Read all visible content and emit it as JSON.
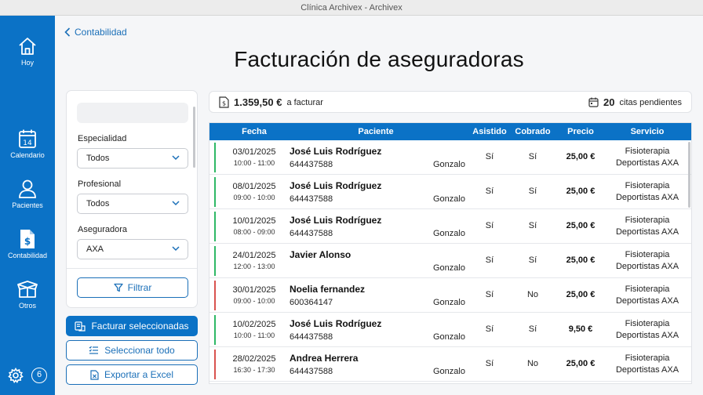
{
  "window": {
    "title": "Clínica Archivex - Archivex"
  },
  "sidebar": {
    "items": [
      {
        "label": "Hoy",
        "icon": "home-icon"
      },
      {
        "label": "Calendario",
        "icon": "calendar-icon",
        "day": "14"
      },
      {
        "label": "Pacientes",
        "icon": "user-icon"
      },
      {
        "label": "Contabilidad",
        "icon": "invoice-icon"
      },
      {
        "label": "Otros",
        "icon": "box-icon"
      }
    ],
    "badge": "6"
  },
  "breadcrumb": {
    "back_label": "Contabilidad"
  },
  "page": {
    "title": "Facturación de aseguradoras"
  },
  "filters": {
    "especialidad": {
      "label": "Especialidad",
      "value": "Todos"
    },
    "profesional": {
      "label": "Profesional",
      "value": "Todos"
    },
    "aseguradora": {
      "label": "Aseguradora",
      "value": "AXA"
    },
    "filter_button": "Filtrar"
  },
  "actions": {
    "facturar": "Facturar seleccionadas",
    "seleccionar": "Seleccionar todo",
    "exportar": "Exportar a Excel"
  },
  "summary": {
    "amount": "1.359,50 €",
    "amount_suffix": "a facturar",
    "count": "20",
    "count_suffix": "citas pendientes"
  },
  "table": {
    "headers": [
      "Fecha",
      "Paciente",
      "Asistido",
      "Cobrado",
      "Precio",
      "Servicio"
    ],
    "rows": [
      {
        "date": "03/01/2025",
        "time": "10:00 - 11:00",
        "name": "José Luis Rodríguez",
        "phone": "644437588",
        "professional": "Gonzalo",
        "asistido": "Sí",
        "cobrado": "Sí",
        "precio": "25,00 €",
        "servicio1": "Fisioterapia",
        "servicio2": "Deportistas AXA",
        "status": "green"
      },
      {
        "date": "08/01/2025",
        "time": "09:00 - 10:00",
        "name": "José Luis Rodríguez",
        "phone": "644437588",
        "professional": "Gonzalo",
        "asistido": "Sí",
        "cobrado": "Sí",
        "precio": "25,00 €",
        "servicio1": "Fisioterapia",
        "servicio2": "Deportistas AXA",
        "status": "green"
      },
      {
        "date": "10/01/2025",
        "time": "08:00 - 09:00",
        "name": "José Luis Rodríguez",
        "phone": "644437588",
        "professional": "Gonzalo",
        "asistido": "Sí",
        "cobrado": "Sí",
        "precio": "25,00 €",
        "servicio1": "Fisioterapia",
        "servicio2": "Deportistas AXA",
        "status": "green"
      },
      {
        "date": "24/01/2025",
        "time": "12:00 - 13:00",
        "name": "Javier Alonso",
        "phone": "",
        "professional": "Gonzalo",
        "asistido": "Sí",
        "cobrado": "Sí",
        "precio": "25,00 €",
        "servicio1": "Fisioterapia",
        "servicio2": "Deportistas AXA",
        "status": "green"
      },
      {
        "date": "30/01/2025",
        "time": "09:00 - 10:00",
        "name": "Noelia fernandez",
        "phone": "600364147",
        "professional": "Gonzalo",
        "asistido": "Sí",
        "cobrado": "No",
        "precio": "25,00 €",
        "servicio1": "Fisioterapia",
        "servicio2": "Deportistas AXA",
        "status": "red"
      },
      {
        "date": "10/02/2025",
        "time": "10:00 - 11:00",
        "name": "José Luis Rodríguez",
        "phone": "644437588",
        "professional": "Gonzalo",
        "asistido": "Sí",
        "cobrado": "Sí",
        "precio": "9,50 €",
        "servicio1": "Fisioterapia",
        "servicio2": "Deportistas AXA",
        "status": "green"
      },
      {
        "date": "28/02/2025",
        "time": "16:30 - 17:30",
        "name": "Andrea Herrera",
        "phone": "644437588",
        "professional": "Gonzalo",
        "asistido": "Sí",
        "cobrado": "No",
        "precio": "25,00 €",
        "servicio1": "Fisioterapia",
        "servicio2": "Deportistas AXA",
        "status": "red"
      }
    ]
  },
  "colors": {
    "primary": "#0b72c6",
    "status_green": "#2fb866",
    "status_red": "#d9534f"
  }
}
